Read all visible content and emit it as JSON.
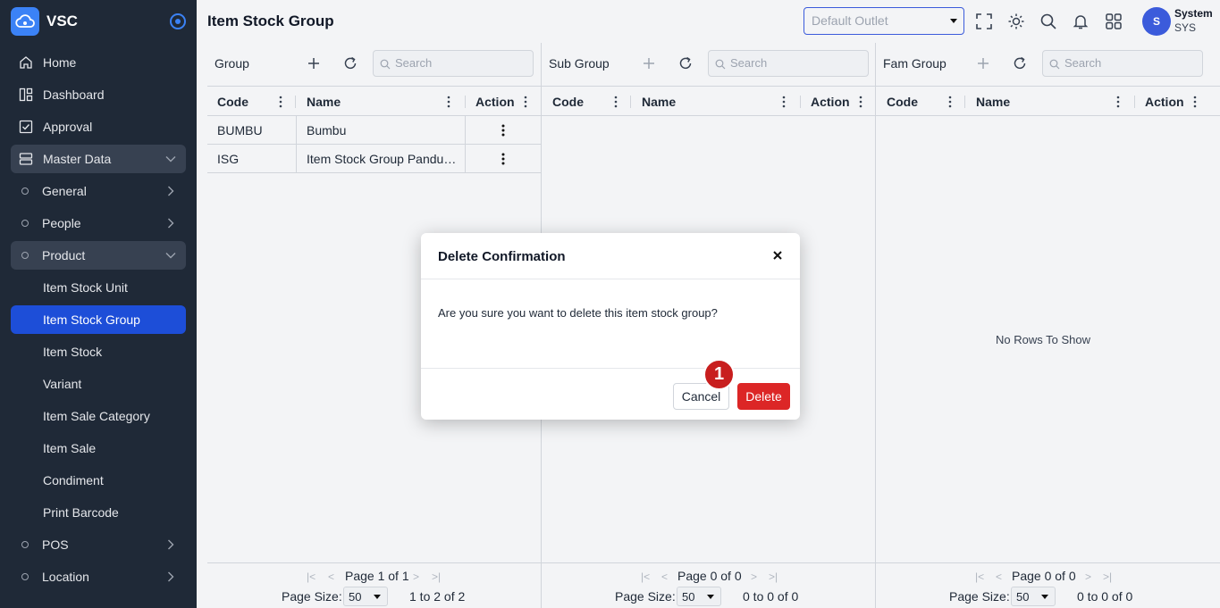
{
  "app": {
    "name": "VSC"
  },
  "sidebar": {
    "items": [
      {
        "label": "Home",
        "icon": "home-icon"
      },
      {
        "label": "Dashboard",
        "icon": "dashboard-icon"
      },
      {
        "label": "Approval",
        "icon": "approval-icon"
      },
      {
        "label": "Master Data",
        "icon": "database-icon"
      },
      {
        "label": "General"
      },
      {
        "label": "People"
      },
      {
        "label": "Product"
      },
      {
        "label": "Item Stock Unit"
      },
      {
        "label": "Item Stock Group"
      },
      {
        "label": "Item Stock"
      },
      {
        "label": "Variant"
      },
      {
        "label": "Item Sale Category"
      },
      {
        "label": "Item Sale"
      },
      {
        "label": "Condiment"
      },
      {
        "label": "Print Barcode"
      },
      {
        "label": "POS"
      },
      {
        "label": "Location"
      }
    ]
  },
  "header": {
    "title": "Item Stock Group",
    "outlet_placeholder": "Default Outlet",
    "user": {
      "initial": "S",
      "name": "System",
      "code": "SYS"
    }
  },
  "panels": [
    {
      "title": "Group",
      "search_placeholder": "Search",
      "columns": [
        "Code",
        "Name",
        "Action"
      ],
      "rows": [
        {
          "code": "BUMBU",
          "name": "Bumbu"
        },
        {
          "code": "ISG",
          "name": "Item Stock Group Pandua..."
        }
      ],
      "pager": {
        "page": "Page 1 of 1",
        "size_label": "Page Size:",
        "size": "50",
        "count": "1 to 2 of 2"
      }
    },
    {
      "title": "Sub Group",
      "search_placeholder": "Search",
      "columns": [
        "Code",
        "Name",
        "Action"
      ],
      "rows": [],
      "pager": {
        "page": "Page 0 of 0",
        "size_label": "Page Size:",
        "size": "50",
        "count": "0 to 0 of 0"
      }
    },
    {
      "title": "Fam Group",
      "search_placeholder": "Search",
      "columns": [
        "Code",
        "Name",
        "Action"
      ],
      "rows": [],
      "empty_text": "No Rows To Show",
      "pager": {
        "page": "Page 0 of 0",
        "size_label": "Page Size:",
        "size": "50",
        "count": "0 to 0 of 0"
      }
    }
  ],
  "modal": {
    "title": "Delete Confirmation",
    "message": "Are you sure you want to delete this item stock group?",
    "cancel_label": "Cancel",
    "delete_label": "Delete",
    "step_badge": "1"
  },
  "colors": {
    "sidebar_bg": "#1f2937",
    "accent": "#1d4ed8",
    "danger": "#dc2626"
  }
}
